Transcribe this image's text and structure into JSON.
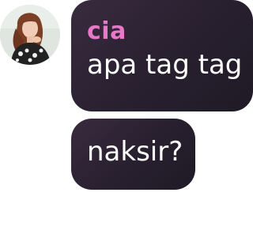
{
  "chat": {
    "avatar_icon": "user-avatar-photo",
    "sender_name": "cia",
    "sender_color": "#e878c8",
    "bubble_color": "#2a2131",
    "messages": [
      {
        "text": "apa tag tag"
      },
      {
        "text": "naksir?"
      }
    ]
  }
}
